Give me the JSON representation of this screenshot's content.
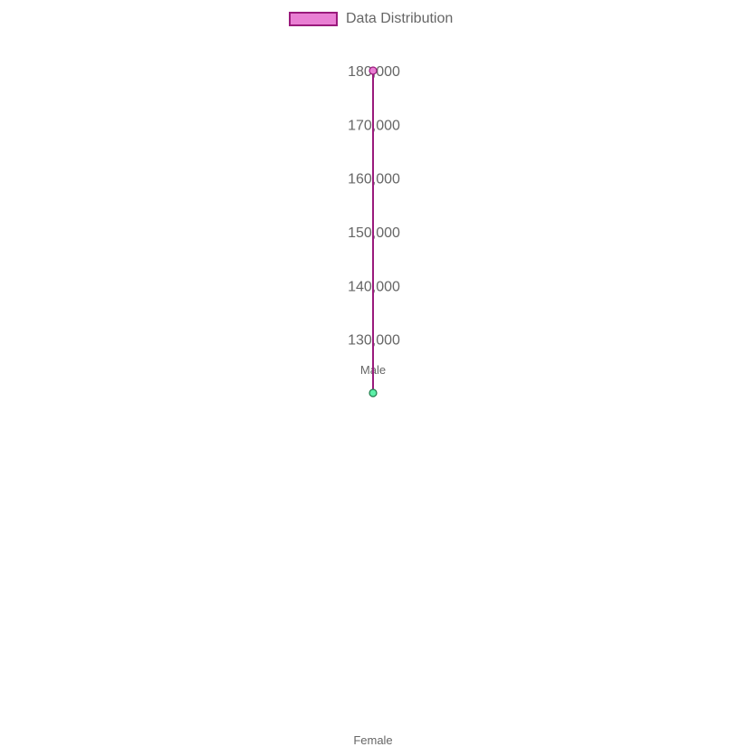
{
  "chart_data": {
    "type": "radar",
    "legend": {
      "label": "Data Distribution",
      "position": "top"
    },
    "categories": [
      "Male",
      "Female"
    ],
    "series": [
      {
        "name": "Data Distribution",
        "values": [
          180000,
          120000
        ]
      }
    ],
    "r_axis": {
      "ticks": [
        "130,000",
        "140,000",
        "150,000",
        "160,000",
        "170,000",
        "180,000"
      ],
      "tick_values": [
        130000,
        140000,
        150000,
        160000,
        170000,
        180000
      ],
      "min": 120000,
      "max": 180000
    },
    "colors": {
      "fill": "#e97fd3",
      "line": "#9a1a7c",
      "male_point": "#e97fd3",
      "female_point": "#5cf0a8",
      "female_point_border": "#1e7a4a",
      "axis_line": "#a0a0a0",
      "text": "#666666"
    }
  }
}
